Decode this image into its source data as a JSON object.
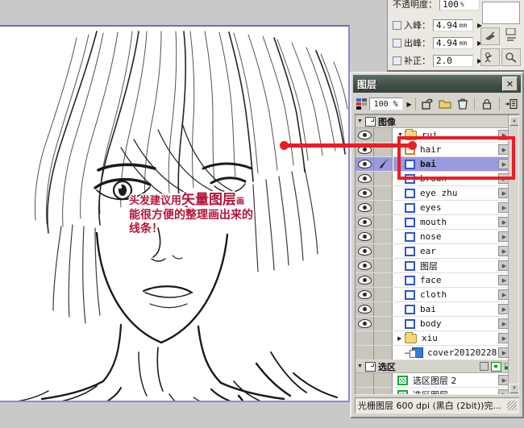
{
  "tool_options": {
    "opacity": {
      "label": "不透明度：",
      "value": "100",
      "unit": "%"
    },
    "rows": [
      {
        "label": "入峰：",
        "value": "4.94",
        "unit": "mm",
        "checked": false
      },
      {
        "label": "出峰：",
        "value": "4.94",
        "unit": "mm",
        "checked": false
      },
      {
        "label": "补正：",
        "value": "2.0",
        "unit": "",
        "checked": false
      }
    ],
    "buttons": [
      "brush-tool-1",
      "brush-tool-2",
      "brush-tool-3",
      "brush-tool-4"
    ]
  },
  "annotation": {
    "line1_a": "头发建议用",
    "line1_b": "矢量图层",
    "line1_c": "画",
    "line2": "能很方便的整理画出来的",
    "line3": "线条！",
    "highlight_color": "#ed1c24",
    "text_color": "#b6153a"
  },
  "layers_panel": {
    "title": "图层",
    "close_label": "✕",
    "toolbar": {
      "opacity_value": "100 %",
      "arrow": "▶",
      "icons": [
        "new-layer-icon",
        "new-folder-icon",
        "delete-layer-icon",
        "lock-layer-icon",
        "panel-menu-icon"
      ]
    },
    "groups": [
      {
        "name": "group-image",
        "label": "图像",
        "expanded": true
      },
      {
        "name": "group-selection",
        "label": "选区",
        "expanded": true
      }
    ],
    "layers": [
      {
        "name": "rui",
        "type": "folder",
        "visible": true,
        "expanded": true,
        "selected": false,
        "indent": 0,
        "tool": false
      },
      {
        "name": "hair",
        "type": "vector",
        "visible": true,
        "selected": false,
        "indent": 1,
        "tool": false,
        "thumb": "orange"
      },
      {
        "name": "bai",
        "type": "vector",
        "visible": true,
        "selected": true,
        "indent": 1,
        "tool": true,
        "thumb": "blue"
      },
      {
        "name": "brown",
        "type": "vector",
        "visible": true,
        "selected": false,
        "indent": 1,
        "tool": false,
        "thumb": "blue"
      },
      {
        "name": "eye zhu",
        "type": "vector",
        "visible": true,
        "selected": false,
        "indent": 1,
        "tool": false,
        "thumb": "blue"
      },
      {
        "name": "eyes",
        "type": "vector",
        "visible": true,
        "selected": false,
        "indent": 1,
        "tool": false,
        "thumb": "blue"
      },
      {
        "name": "mouth",
        "type": "vector",
        "visible": true,
        "selected": false,
        "indent": 1,
        "tool": false,
        "thumb": "blue"
      },
      {
        "name": "nose",
        "type": "vector",
        "visible": true,
        "selected": false,
        "indent": 1,
        "tool": false,
        "thumb": "blue"
      },
      {
        "name": "ear",
        "type": "vector",
        "visible": true,
        "selected": false,
        "indent": 1,
        "tool": false,
        "thumb": "blue"
      },
      {
        "name": "图层",
        "type": "vector",
        "visible": true,
        "selected": false,
        "indent": 1,
        "tool": false,
        "thumb": "blue",
        "cjk": true
      },
      {
        "name": "face",
        "type": "vector",
        "visible": true,
        "selected": false,
        "indent": 1,
        "tool": false,
        "thumb": "blue"
      },
      {
        "name": "cloth",
        "type": "vector",
        "visible": true,
        "selected": false,
        "indent": 1,
        "tool": false,
        "thumb": "blue"
      },
      {
        "name": "bai",
        "type": "vector",
        "visible": true,
        "selected": false,
        "indent": 1,
        "tool": false,
        "thumb": "blue"
      },
      {
        "name": "body",
        "type": "vector",
        "visible": true,
        "selected": false,
        "indent": 1,
        "tool": false,
        "thumb": "blue"
      },
      {
        "name": "xiu",
        "type": "folder",
        "visible": false,
        "expanded": false,
        "selected": false,
        "indent": 0,
        "tool": false
      },
      {
        "name": "cover20120228",
        "type": "raster",
        "visible": false,
        "selected": false,
        "indent": 0,
        "tool": false,
        "thumb": "blue-stack"
      }
    ],
    "selection_layers": [
      {
        "name": "选区图层 2",
        "type": "selection",
        "cjk": true
      },
      {
        "name": "选区图层",
        "type": "selection",
        "cjk": true
      }
    ],
    "status_text": "光栅图层 600 dpi (黑白 (2bit))完..."
  },
  "canvas": {
    "artwork_description": "manga-lineart-male-character",
    "border_color": "#6a6ad6",
    "background": "#ffffff"
  }
}
